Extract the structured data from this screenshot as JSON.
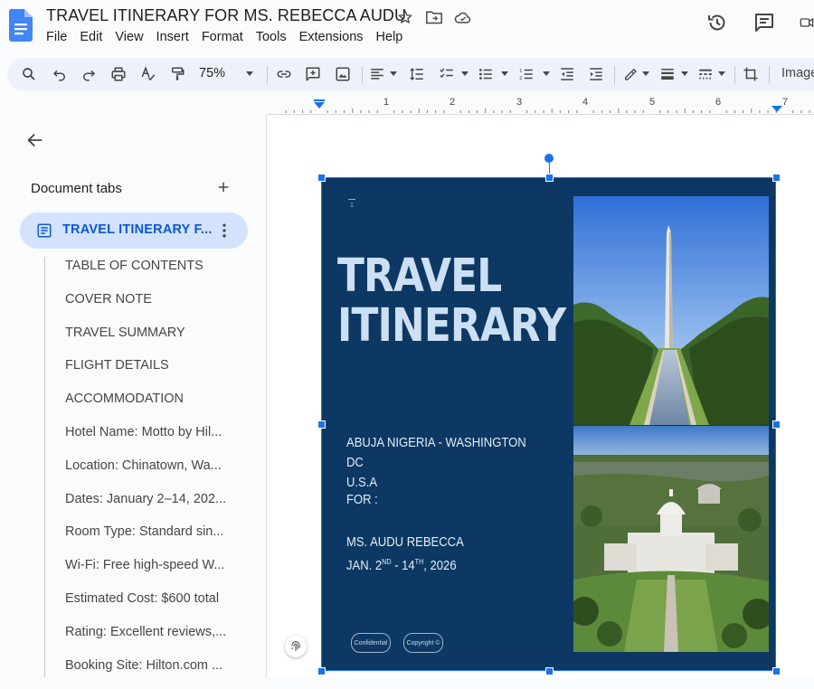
{
  "title_bar": {
    "document_title": "TRAVEL ITINERARY FOR MS. REBECCA AUDU",
    "icons": [
      "star-icon",
      "move-to-folder-icon",
      "cloud-saved-icon"
    ],
    "right_icons": [
      "version-history-icon",
      "comments-icon",
      "meet-icon"
    ]
  },
  "menu": {
    "items": [
      "File",
      "Edit",
      "View",
      "Insert",
      "Format",
      "Tools",
      "Extensions",
      "Help"
    ]
  },
  "toolbar": {
    "zoom": "75%",
    "image_options_label": "Image"
  },
  "ruler": {
    "numbers": [
      "1",
      "2",
      "3",
      "4",
      "5",
      "6",
      "7"
    ]
  },
  "sidebar": {
    "heading": "Document tabs",
    "active_tab": "TRAVEL ITINERARY F...",
    "outline": [
      "TABLE OF CONTENTS",
      "COVER NOTE",
      "TRAVEL SUMMARY",
      "FLIGHT DETAILS",
      "ACCOMMODATION",
      "Hotel Name: Motto by Hil...",
      "Location: Chinatown, Wa...",
      "Dates: January 2–14, 202...",
      "Room Type: Standard sin...",
      "Wi-Fi: Free high-speed W...",
      "Estimated Cost: $600 total",
      "Rating: Excellent reviews,...",
      "Booking Site: Hilton.com ..."
    ]
  },
  "cover": {
    "page_marker": "1",
    "title_line1": "TRAVEL",
    "title_line2": "ITINERARY",
    "route_line1": "ABUJA NIGERIA - WASHINGTON DC",
    "route_line2": "U.S.A",
    "for_label": "FOR :",
    "name": "MS. AUDU REBECCA",
    "dates_prefix": "JAN. 2",
    "dates_sup1": "ND",
    "dates_mid": " - 14",
    "dates_sup2": "TH",
    "dates_suffix": ", 2026",
    "badge_left": "Confidential",
    "badge_right": "Copyright ©",
    "background_color": "#0c3863",
    "title_color": "#ccdff3"
  },
  "colors": {
    "accent": "#0b57d0",
    "selection": "#1a73e8",
    "active_tab_bg": "#d3e3fd",
    "toolbar_bg": "#edf2fa"
  }
}
